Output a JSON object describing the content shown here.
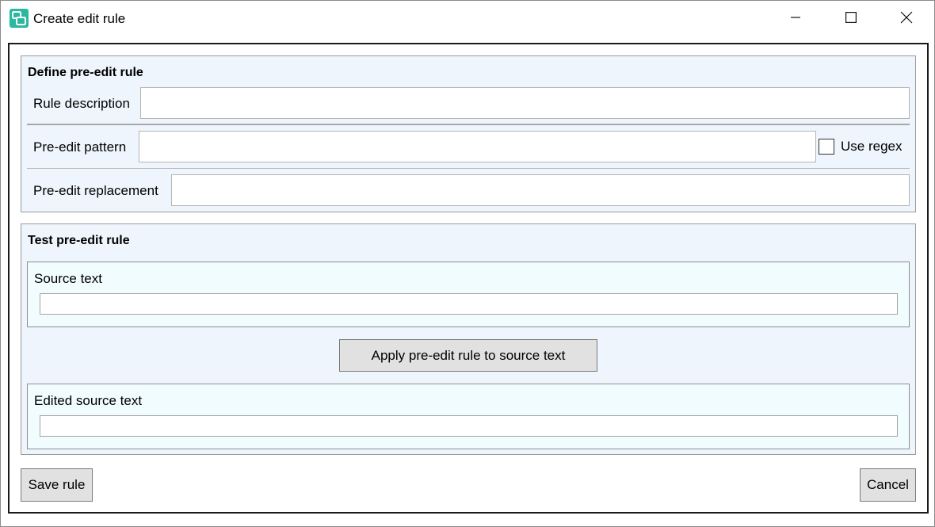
{
  "window": {
    "title": "Create edit rule",
    "icons": {
      "app": "speech-bubbles-icon",
      "minimize": "minimize-icon",
      "maximize": "maximize-icon",
      "close": "close-icon"
    },
    "accent_color": "#2bb8a0"
  },
  "define_group": {
    "title": "Define pre-edit rule",
    "rule_description": {
      "label": "Rule description",
      "value": "",
      "placeholder": ""
    },
    "pre_edit_pattern": {
      "label": "Pre-edit pattern",
      "value": "",
      "placeholder": ""
    },
    "use_regex": {
      "label": "Use regex",
      "checked": false
    },
    "pre_edit_replacement": {
      "label": "Pre-edit replacement",
      "value": "",
      "placeholder": ""
    }
  },
  "test_group": {
    "title": "Test pre-edit rule",
    "source_text": {
      "label": "Source text",
      "value": ""
    },
    "apply_button": "Apply pre-edit rule to source text",
    "edited_source_text": {
      "label": "Edited source text",
      "value": ""
    }
  },
  "footer": {
    "save_button": "Save rule",
    "cancel_button": "Cancel"
  }
}
